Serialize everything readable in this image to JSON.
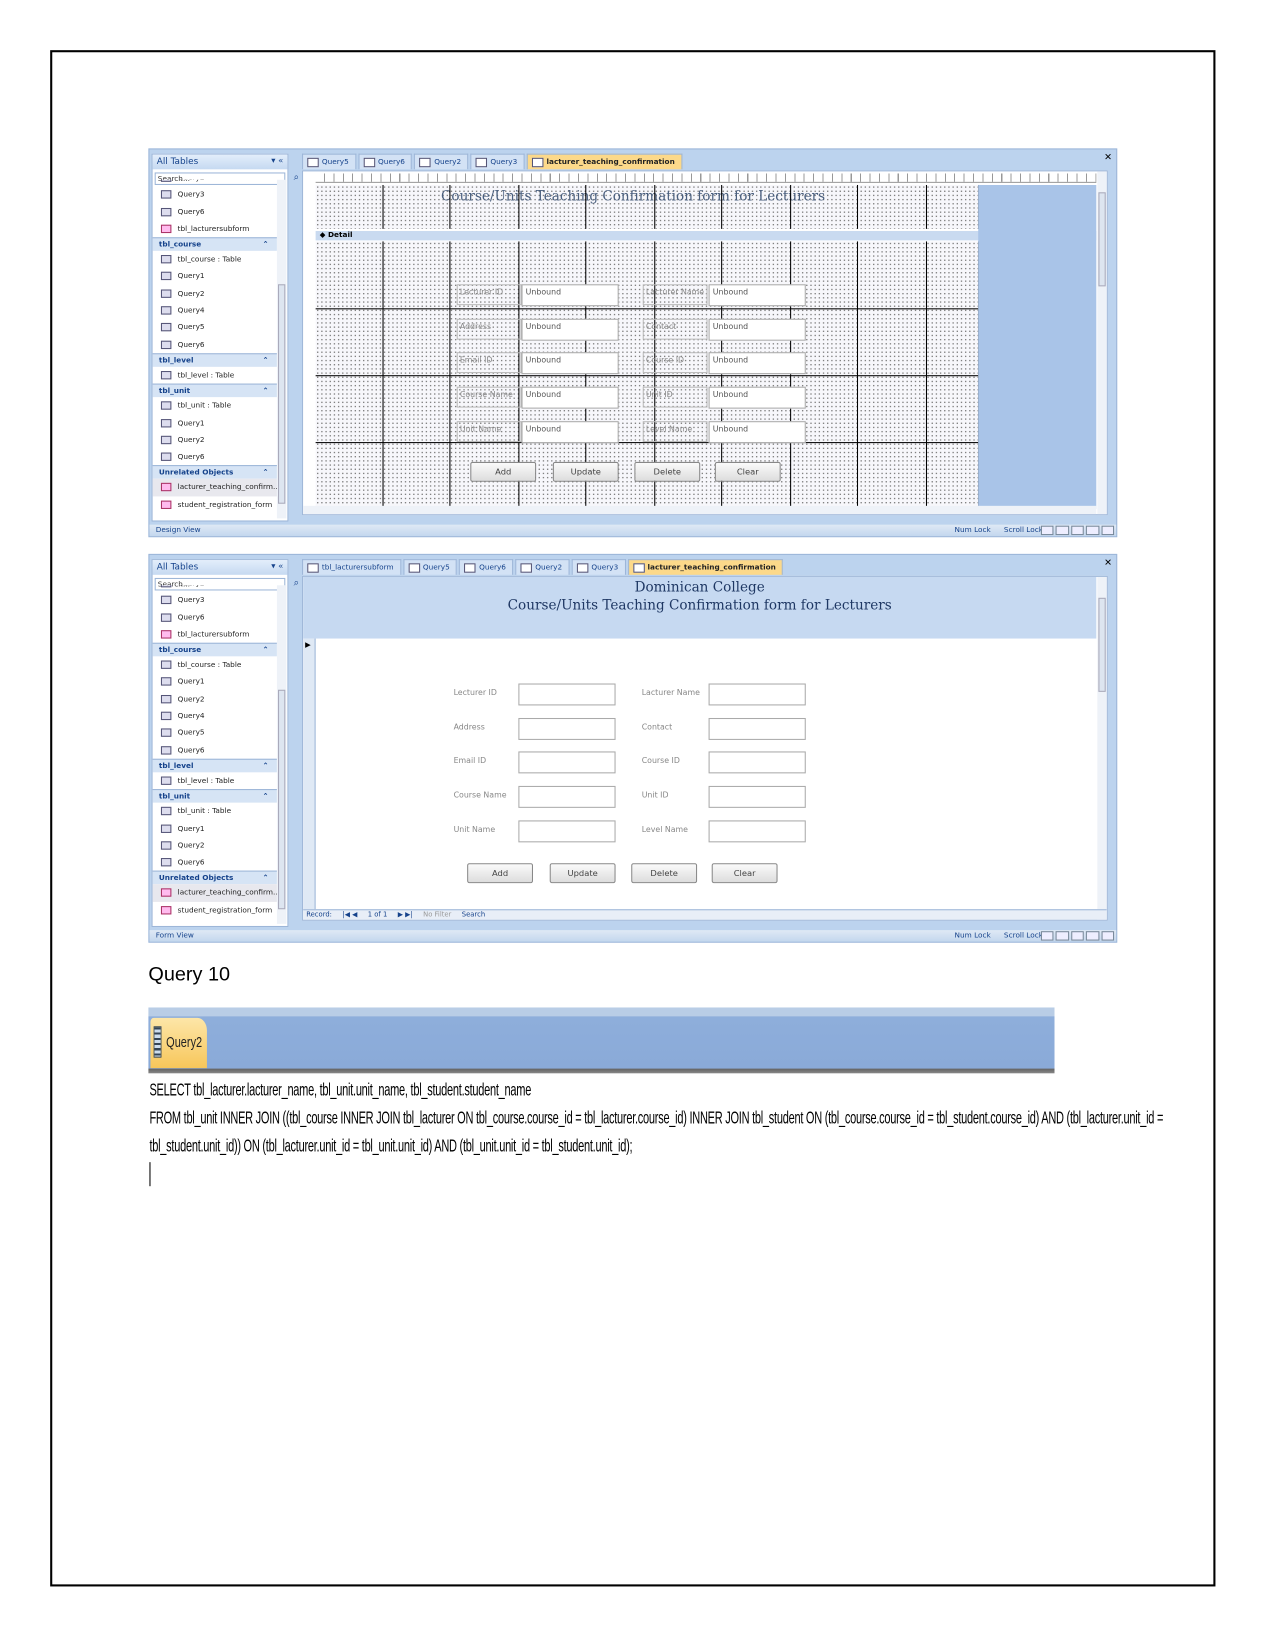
{
  "nav_pane": {
    "title": "All Tables",
    "search_placeholder": "Search...",
    "items": [
      {
        "type": "query",
        "label": "Query2"
      },
      {
        "type": "query",
        "label": "Query3"
      },
      {
        "type": "query",
        "label": "Query6"
      },
      {
        "type": "form",
        "label": "tbl_lacturersubform"
      },
      {
        "type": "group",
        "label": "tbl_course"
      },
      {
        "type": "table",
        "label": "tbl_course : Table"
      },
      {
        "type": "query",
        "label": "Query1"
      },
      {
        "type": "query",
        "label": "Query2"
      },
      {
        "type": "query",
        "label": "Query4"
      },
      {
        "type": "query",
        "label": "Query5"
      },
      {
        "type": "query",
        "label": "Query6"
      },
      {
        "type": "group",
        "label": "tbl_level"
      },
      {
        "type": "table",
        "label": "tbl_level : Table"
      },
      {
        "type": "group",
        "label": "tbl_unit"
      },
      {
        "type": "table",
        "label": "tbl_unit : Table"
      },
      {
        "type": "query",
        "label": "Query1"
      },
      {
        "type": "query",
        "label": "Query2"
      },
      {
        "type": "query",
        "label": "Query6"
      },
      {
        "type": "group",
        "label": "Unrelated Objects"
      },
      {
        "type": "form",
        "label": "lacturer_teaching_confirm...",
        "selected": true
      },
      {
        "type": "form",
        "label": "student_registration_form"
      }
    ]
  },
  "design_window": {
    "tabs": [
      "Query5",
      "Query6",
      "Query2",
      "Query3",
      "lacturer_teaching_confirmation"
    ],
    "active_tab": 4,
    "form_title": "Course/Units Teaching Confirmation form for Lecturers",
    "detail_label": "Detail",
    "unbound": "Unbound",
    "status": "Design View",
    "num_lock": "Num Lock",
    "scroll_lock": "Scroll Lock"
  },
  "form_window": {
    "tabs": [
      "tbl_lacturersubform",
      "Query5",
      "Query6",
      "Query2",
      "Query3",
      "lacturer_teaching_confirmation"
    ],
    "active_tab": 5,
    "college": "Dominican College",
    "form_title": "Course/Units Teaching Confirmation form for Lecturers",
    "record_label": "Record:",
    "record_pos": "1 of 1",
    "no_filter": "No Filter",
    "search": "Search",
    "status": "Form View",
    "num_lock": "Num Lock",
    "scroll_lock": "Scroll Lock"
  },
  "fields": [
    [
      "Lecturer ID",
      "Lacturer Name"
    ],
    [
      "Address",
      "Contact"
    ],
    [
      "Email ID",
      "Course ID"
    ],
    [
      "Course Name",
      "Unit ID"
    ],
    [
      "Unit Name",
      "Level Name"
    ]
  ],
  "buttons": [
    "Add",
    "Update",
    "Delete",
    "Clear"
  ],
  "caption": "Query 10",
  "query_tab": "Query2",
  "sql_lines": [
    "SELECT tbl_lacturer.lacturer_name, tbl_unit.unit_name, tbl_student.student_name",
    "FROM tbl_unit INNER JOIN ((tbl_course INNER JOIN tbl_lacturer ON tbl_course.course_id = tbl_lacturer.course_id) INNER JOIN tbl_student ON (tbl_course.course_id = tbl_student.course_id) AND (tbl_lacturer.unit_id =",
    "tbl_student.unit_id)) ON (tbl_lacturer.unit_id = tbl_unit.unit_id) AND (tbl_unit.unit_id = tbl_student.unit_id);"
  ]
}
